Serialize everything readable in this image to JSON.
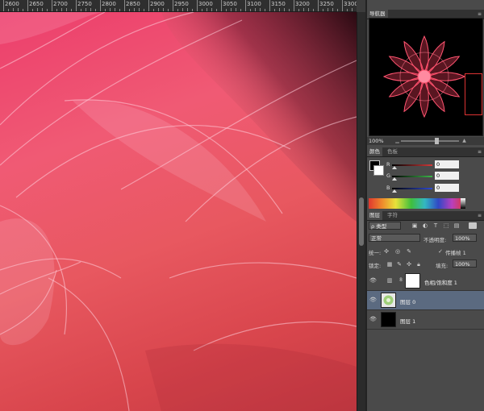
{
  "ruler": {
    "ticks": [
      "2600",
      "2650",
      "2700",
      "2750",
      "2800",
      "2850",
      "2900",
      "2950",
      "3000",
      "3050",
      "3100",
      "3150",
      "3200",
      "3250",
      "3300"
    ]
  },
  "navigator": {
    "tab_label": "导航器",
    "zoom": "100%"
  },
  "color_panel": {
    "tabs": [
      "颜色",
      "色板"
    ],
    "channels": [
      {
        "label": "R",
        "value": "0",
        "color": "#d23a3a"
      },
      {
        "label": "G",
        "value": "0",
        "color": "#3db54a"
      },
      {
        "label": "B",
        "value": "0",
        "color": "#2f4ad0"
      }
    ]
  },
  "layers_panel": {
    "tabs": [
      "图层",
      "字符"
    ],
    "filter_label": "ρ 类型",
    "blend_mode": "正常",
    "opacity_label": "不透明度:",
    "opacity_value": "100%",
    "unify_label": "统一:",
    "propagate_label": "传播帧 1",
    "lock_label": "锁定:",
    "fill_label": "填充:",
    "fill_value": "100%",
    "layers": [
      {
        "name": "色相/饱和度 1",
        "selected": false
      },
      {
        "name": "图层 0",
        "selected": true
      },
      {
        "name": "图层 1",
        "selected": false
      }
    ]
  },
  "colors": {
    "selection": "#5b6a80",
    "panel_bg": "#4a4a4a",
    "canvas_pink": "#ec3e6c"
  }
}
